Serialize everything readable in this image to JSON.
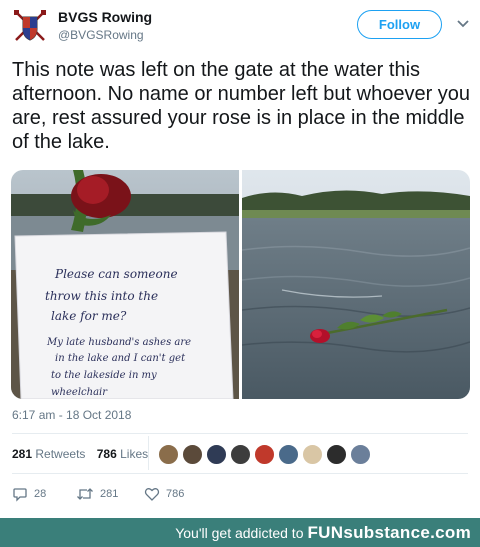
{
  "account": {
    "name": "BVGS Rowing",
    "handle": "@BVGSRowing",
    "follow_label": "Follow"
  },
  "tweet": {
    "text": "This note was left on the gate at the water this afternoon. No name or number left but whoever you are, rest assured your rose is in place in the middle of the lake.",
    "timestamp": "6:17 am - 18 Oct 2018"
  },
  "photos": [
    {
      "note_lines": [
        "Please can someone",
        "throw this into the",
        "lake for me?",
        "My late husband's ashes are",
        "in the lake and I can't get",
        "to the lakeside in my",
        "wheelchair"
      ]
    },
    {}
  ],
  "stats": {
    "retweets_count": "281",
    "retweets_label": "Retweets",
    "likes_count": "786",
    "likes_label": "Likes"
  },
  "likers": [
    "#8a6d4b",
    "#5b4a3a",
    "#2f3b55",
    "#3d3d3d",
    "#c0392b",
    "#4a6a8a",
    "#d9c6a5",
    "#2c2c2c",
    "#6b7f9a"
  ],
  "actions": {
    "replies": "28",
    "retweets": "281",
    "likes": "786"
  },
  "footer": {
    "tagline": "You'll get addicted to",
    "brand": "FUNsubstance.com"
  },
  "colors": {
    "accent": "#1da1f2",
    "muted": "#657786",
    "footer_bg": "#3a7f7a"
  }
}
